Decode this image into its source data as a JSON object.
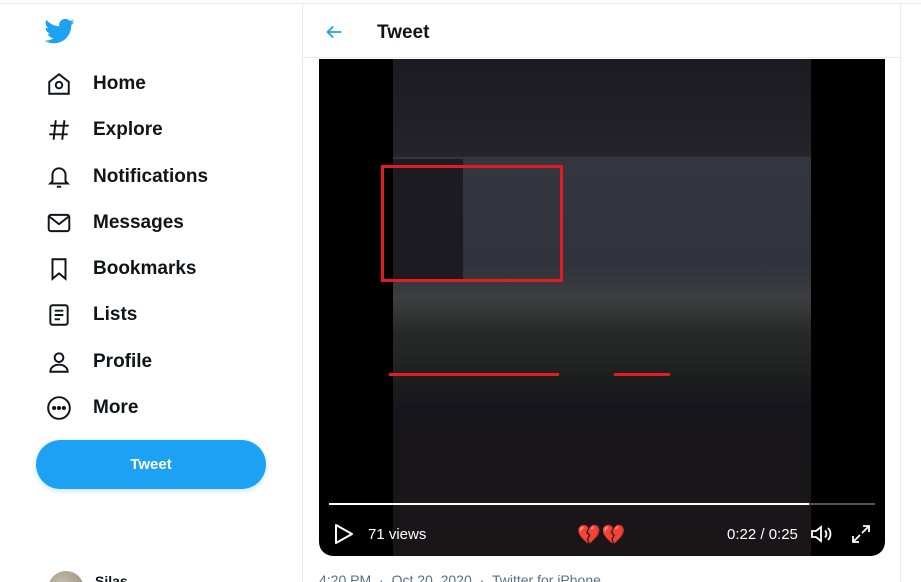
{
  "sidebar": {
    "logo": "twitter-bird-icon",
    "items": [
      {
        "label": "Home",
        "icon": "home-icon"
      },
      {
        "label": "Explore",
        "icon": "hashtag-icon"
      },
      {
        "label": "Notifications",
        "icon": "bell-icon"
      },
      {
        "label": "Messages",
        "icon": "envelope-icon"
      },
      {
        "label": "Bookmarks",
        "icon": "bookmark-icon"
      },
      {
        "label": "Lists",
        "icon": "list-icon"
      },
      {
        "label": "Profile",
        "icon": "person-icon"
      },
      {
        "label": "More",
        "icon": "more-circle-icon"
      }
    ],
    "tweet_button": "Tweet",
    "profile_name": "Silas"
  },
  "header": {
    "title": "Tweet"
  },
  "video": {
    "views": "71 views",
    "emojis": "💔💔",
    "time": "0:22 / 0:25",
    "progress": 0.88
  },
  "tweet_meta": {
    "time": "4:20 PM",
    "sep1": "·",
    "date": "Oct 20, 2020",
    "sep2": "·",
    "source": "Twitter for iPhone"
  },
  "colors": {
    "accent": "#1da1f2",
    "annotation": "#e31b23"
  }
}
